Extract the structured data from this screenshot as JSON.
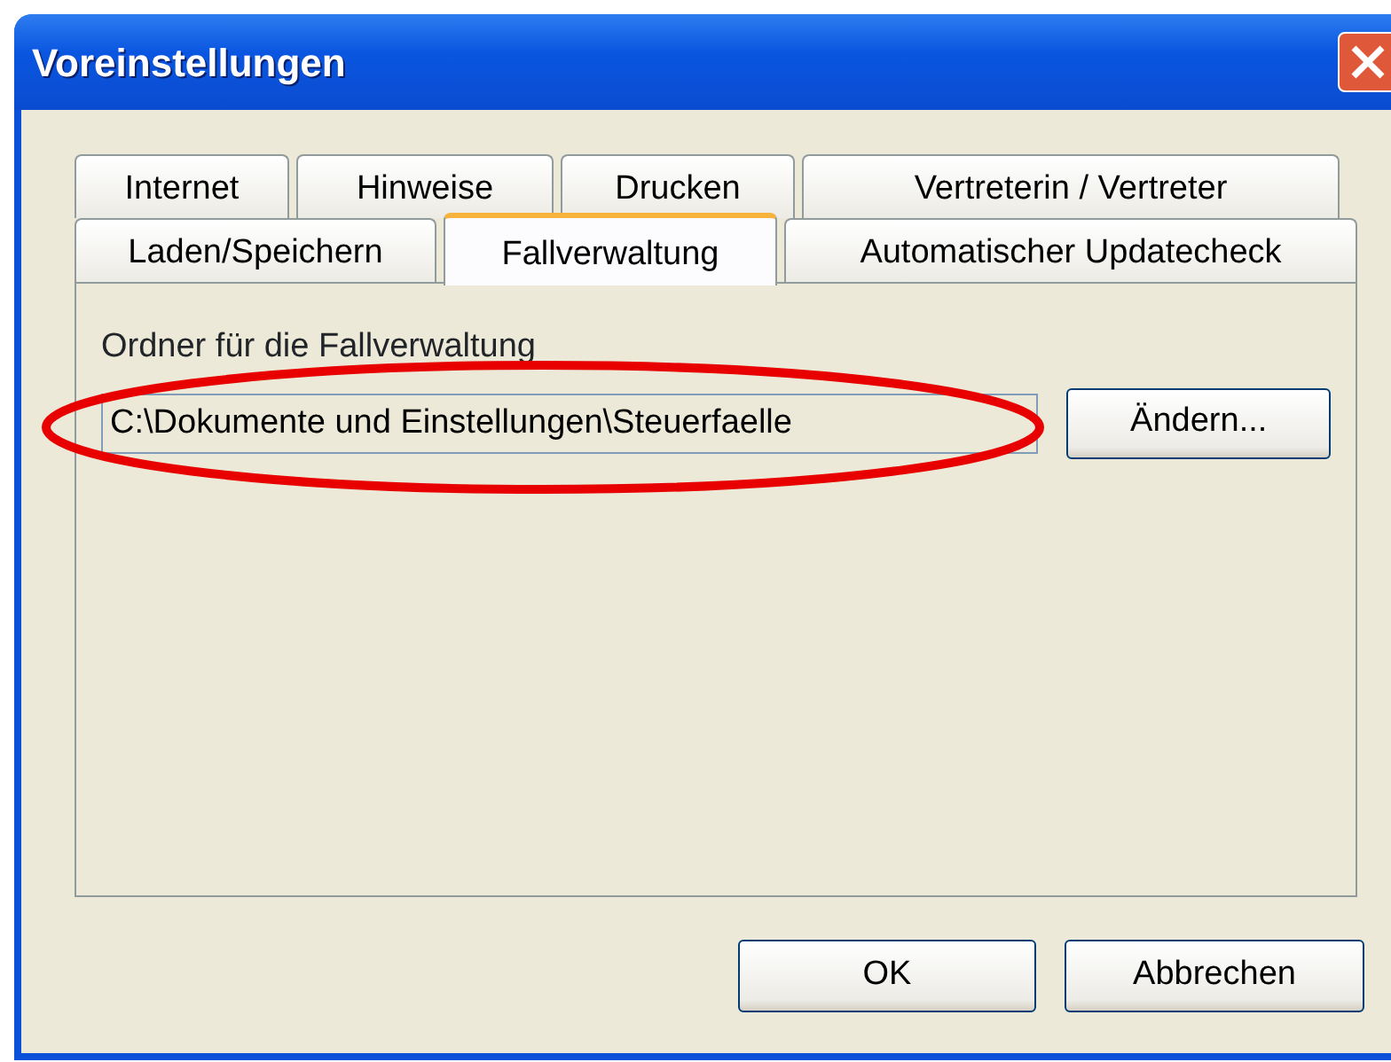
{
  "window": {
    "title": "Voreinstellungen"
  },
  "tab_rows": [
    [
      {
        "label": "Internet",
        "selected": false
      },
      {
        "label": "Hinweise",
        "selected": false
      },
      {
        "label": "Drucken",
        "selected": false
      },
      {
        "label": "Vertreterin / Vertreter",
        "selected": false
      }
    ],
    [
      {
        "label": "Laden/Speichern",
        "selected": false
      },
      {
        "label": "Fallverwaltung",
        "selected": true
      },
      {
        "label": "Automatischer Updatecheck",
        "selected": false
      }
    ]
  ],
  "panel": {
    "label": "Ordner für die Fallverwaltung",
    "folder_value": "C:\\Dokumente und Einstellungen\\Steuerfaelle",
    "change_button": "Ändern..."
  },
  "buttons": [
    "OK",
    "Abbrechen"
  ]
}
